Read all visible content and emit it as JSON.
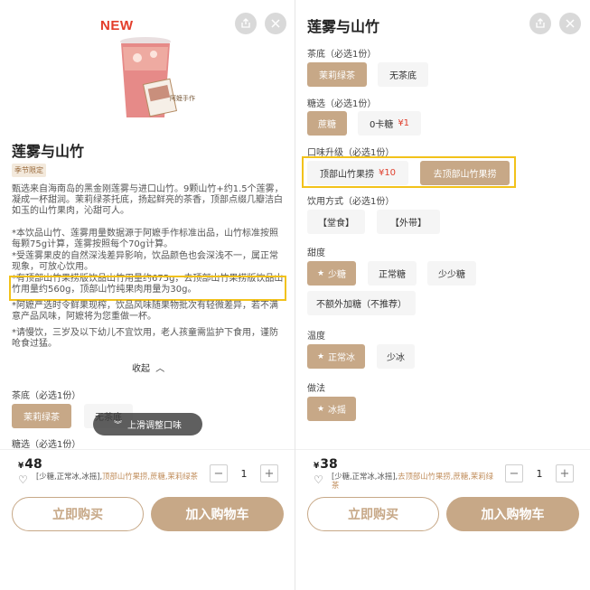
{
  "left": {
    "badge": "NEW",
    "brand_mark": "阿嬷手作",
    "title": "莲雾与山竹",
    "season_tag": "季节限定",
    "desc_intro": "甄选来自海南岛的黑金刚莲雾与进口山竹。9颗山竹+约1.5个莲雾，凝成一杯甜润。茉莉绿茶托底，扬起鲜亮的茶香，顶部点缀几瓣洁白如玉的山竹果肉，沁甜可人。",
    "note1": "*本饮品山竹、莲雾用量数据源于阿嬷手作标准出品，山竹标准按照每颗75g计算，莲雾按照每个70g计算。",
    "note2": "*受莲雾果皮的自然深浅差异影响，饮品颜色也会深浅不一，属正常现象，可放心饮用。",
    "note3": "*有顶部山竹果捞版饮品山竹用量约675g，去顶部山竹果捞版饮品山竹用量约560g，顶部山竹纯果肉用量为30g。",
    "note4": "*阿嬷严选时令鲜果现榨，饮品风味随果物批次有轻微差异，若不满意产品风味，阿嬷将为您重做一杯。",
    "note5": "*请慢饮，三岁及以下幼儿不宜饮用，老人孩童需监护下食用，谨防呛食过猛。",
    "collapse": "收起",
    "tea_label": "茶底（必选1份）",
    "tea_opt1": "茉莉绿茶",
    "tea_opt2": "无茶底",
    "sugar_label": "糖选（必选1份）",
    "toast": "上滑调整口味",
    "price_yen": "¥",
    "price": "48",
    "summary_plain": "[少糖,正常冰,冰摇],",
    "summary_accent": "顶部山竹果捞",
    "summary_tail": ",蔗糖,茉莉绿茶",
    "qty": "1",
    "buy": "立即购买",
    "cart": "加入购物车"
  },
  "right": {
    "title": "莲雾与山竹",
    "tea_label": "茶底（必选1份）",
    "tea_opt1": "茉莉绿茶",
    "tea_opt2": "无茶底",
    "sugar_label": "糖选（必选1份）",
    "sugar_opt1": "蔗糖",
    "sugar_opt2": "0卡糖",
    "sugar_opt2_price": "¥1",
    "upgrade_label": "口味升级（必选1份）",
    "upgrade_opt1": "顶部山竹果捞",
    "upgrade_opt1_price": "¥10",
    "upgrade_opt2": "去顶部山竹果捞",
    "drink_label": "饮用方式（必选1份）",
    "drink_opt1": "【堂食】",
    "drink_opt2": "【外带】",
    "sweet_label": "甜度",
    "sweet_opt1": "少糖",
    "sweet_opt2": "正常糖",
    "sweet_opt3": "少少糖",
    "sweet_opt4": "不额外加糖（不推荐）",
    "temp_label": "温度",
    "temp_opt1": "正常冰",
    "temp_opt2": "少冰",
    "method_label": "做法",
    "method_opt1": "冰摇",
    "price_yen": "¥",
    "price": "38",
    "summary_plain": "[少糖,正常冰,冰摇],",
    "summary_accent": "去顶部山竹果捞",
    "summary_tail": ",蔗糖,茉莉绿茶",
    "qty": "1",
    "buy": "立即购买",
    "cart": "加入购物车"
  },
  "colors": {
    "accent": "#c7a887",
    "highlight_box": "#f2c21a",
    "price_red": "#e0412f",
    "new_red": "#e33d2a"
  }
}
